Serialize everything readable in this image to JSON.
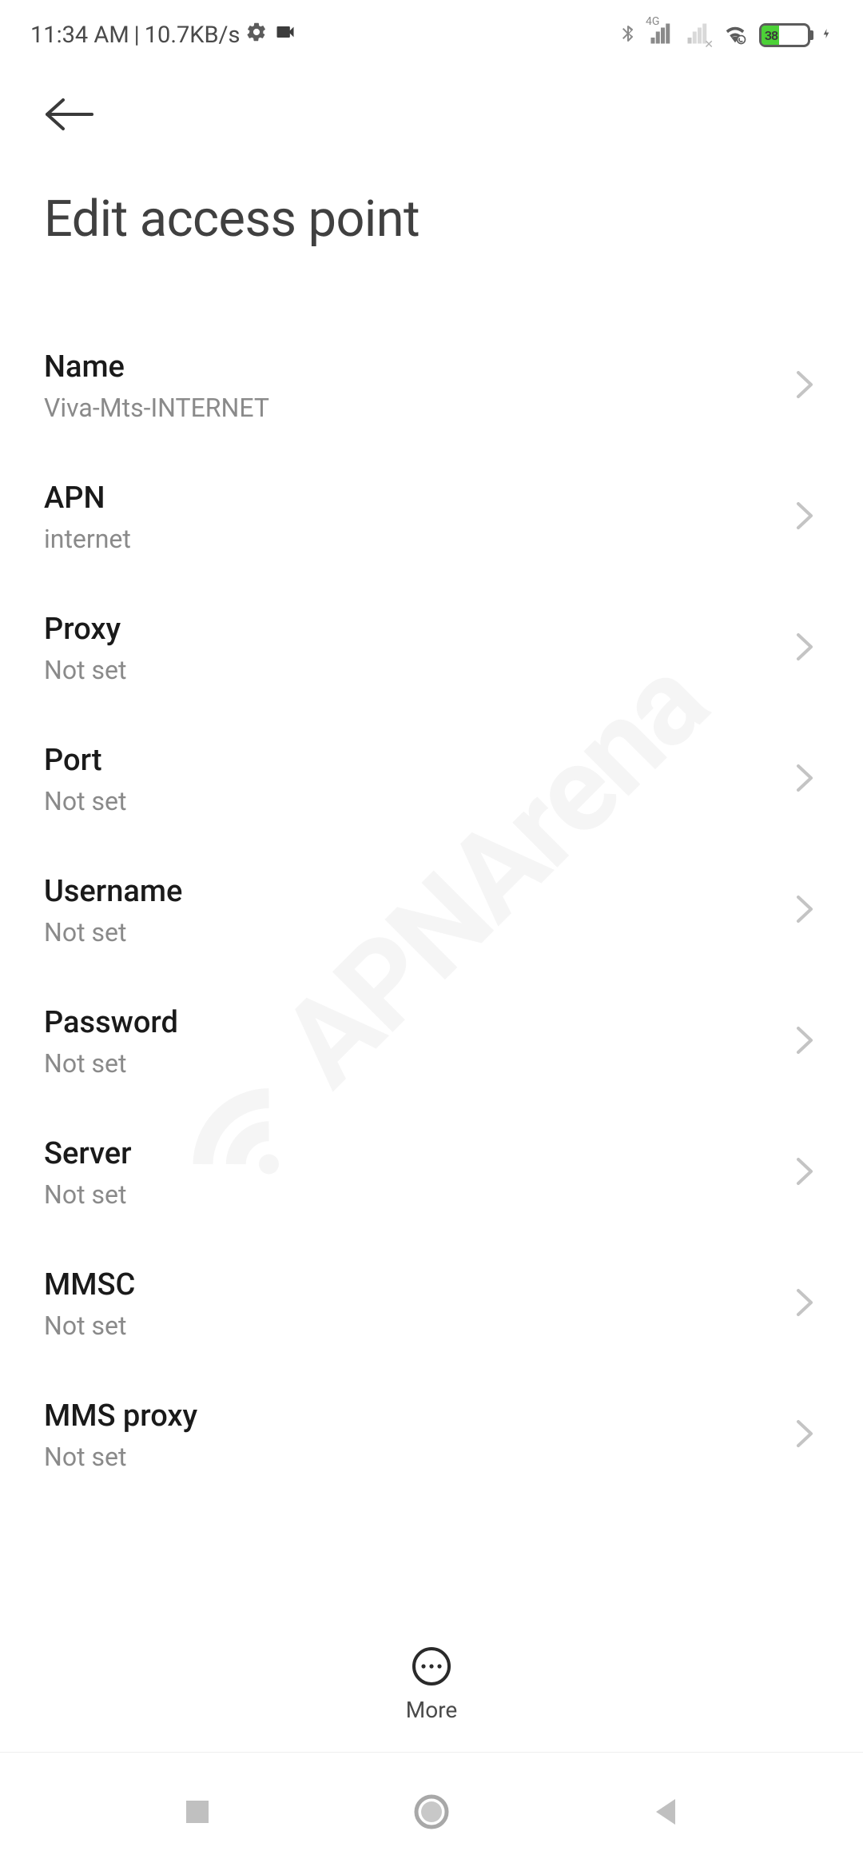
{
  "statusbar": {
    "time": "11:34 AM",
    "separator": "|",
    "data_rate": "10.7KB/s",
    "network_label": "4G",
    "battery_percent": "38"
  },
  "header": {
    "title": "Edit access point"
  },
  "fields": [
    {
      "label": "Name",
      "value": "Viva-Mts-INTERNET"
    },
    {
      "label": "APN",
      "value": "internet"
    },
    {
      "label": "Proxy",
      "value": "Not set"
    },
    {
      "label": "Port",
      "value": "Not set"
    },
    {
      "label": "Username",
      "value": "Not set"
    },
    {
      "label": "Password",
      "value": "Not set"
    },
    {
      "label": "Server",
      "value": "Not set"
    },
    {
      "label": "MMSC",
      "value": "Not set"
    },
    {
      "label": "MMS proxy",
      "value": "Not set"
    }
  ],
  "bottom_action": {
    "label": "More"
  },
  "watermark": {
    "text": "APNArena"
  }
}
